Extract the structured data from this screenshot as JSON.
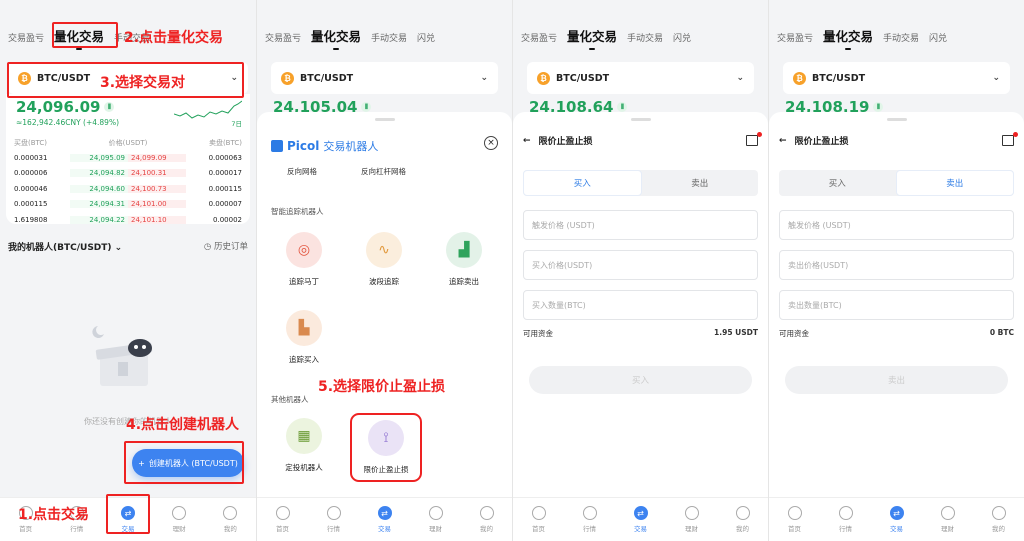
{
  "tabs": {
    "pnl": "交易盈亏",
    "quant": "量化交易",
    "manual": "手动交易",
    "flash": "闪兑"
  },
  "pair": "BTC/USDT",
  "coin_glyph": "₿",
  "panels_price": [
    "24,096.09",
    "24,105.04",
    "24,108.64",
    "24,108.19"
  ],
  "p1": {
    "cny": "≈162,942.46CNY (+4.89%)",
    "spark_label": "7日",
    "ob_headers": {
      "bid": "买盘(BTC)",
      "price": "价格(USDT)",
      "ask": "卖盘(BTC)"
    },
    "orderbook": [
      {
        "bid": "0.000031",
        "bp": "24,095.09",
        "ap": "24,099.09",
        "ask": "0.000063"
      },
      {
        "bid": "0.000006",
        "bp": "24,094.82",
        "ap": "24,100.31",
        "ask": "0.000017"
      },
      {
        "bid": "0.000046",
        "bp": "24,094.60",
        "ap": "24,100.73",
        "ask": "0.000115"
      },
      {
        "bid": "0.000115",
        "bp": "24,094.31",
        "ap": "24,101.00",
        "ask": "0.000007"
      },
      {
        "bid": "1.619808",
        "bp": "24,094.22",
        "ap": "24,101.10",
        "ask": "0.00002"
      }
    ],
    "my_robot": "我的机器人(BTC/USDT)",
    "history": "历史订单",
    "empty_text": "你还没有创建你的机器人",
    "create_btn": "创建机器人 (BTC/USDT)"
  },
  "nav": [
    "首页",
    "行情",
    "交易",
    "理财",
    "我的"
  ],
  "p2": {
    "brand": "Picol",
    "brand_sub": "交易机器人",
    "grid1": "反向网格",
    "grid2": "反向杠杆网格",
    "sec_smart": "智能追踪机器人",
    "tiles": [
      "追踪马丁",
      "波段追踪",
      "追踪卖出",
      "追踪买入"
    ],
    "sec_other": "其他机器人",
    "tiles2": [
      "定投机器人",
      "限价止盈止损"
    ]
  },
  "p3": {
    "title": "限价止盈止损",
    "buy": "买入",
    "sell": "卖出",
    "fields": [
      "触发价格 (USDT)",
      "买入价格(USDT)",
      "买入数量(BTC)"
    ],
    "avail_label": "可用资金",
    "avail_val": "1.95 USDT",
    "submit": "买入"
  },
  "p4": {
    "title": "限价止盈止损",
    "buy": "买入",
    "sell": "卖出",
    "fields": [
      "触发价格 (USDT)",
      "卖出价格(USDT)",
      "卖出数量(BTC)"
    ],
    "avail_label": "可用资金",
    "avail_val": "0 BTC",
    "submit": "卖出"
  },
  "annotations": {
    "a1": "1.点击交易",
    "a2": "2.点击量化交易",
    "a3": "3.选择交易对",
    "a4": "4.点击创建机器人",
    "a5": "5.选择限价止盈止损"
  },
  "colors": {
    "green": "#21a15b",
    "red": "#e64545",
    "blue": "#3d83f0",
    "annotation": "#e22222"
  }
}
